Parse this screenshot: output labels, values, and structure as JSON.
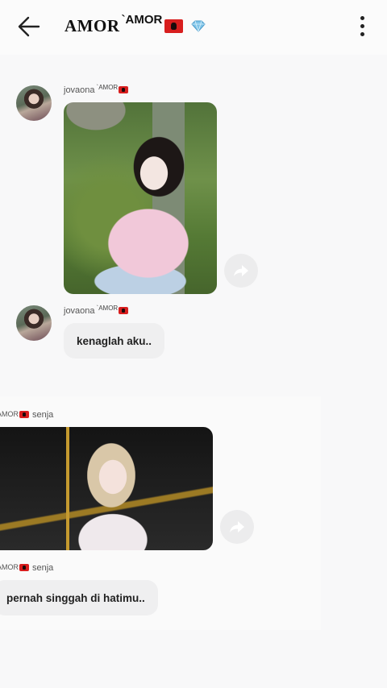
{
  "header": {
    "title_main": "AMOR",
    "title_sup": "`AMOR"
  },
  "messages": [
    {
      "sender_name": "jovaona",
      "sender_sup": "`AMOR",
      "type": "photo"
    },
    {
      "sender_name": "jovaona",
      "sender_sup": "`AMOR",
      "type": "text",
      "text": "kenaglah aku.."
    },
    {
      "sender_prefix": "AMOR",
      "sender_name": "senja",
      "type": "photo"
    },
    {
      "sender_prefix": "AMOR",
      "sender_name": "senja",
      "type": "text",
      "text": "pernah singgah di hatimu.."
    }
  ],
  "colors": {
    "flag": "#d81e1e",
    "bubble": "#efeff0",
    "diamond": "#7fc4e8"
  },
  "icons": [
    "back-arrow-icon",
    "diamond-icon",
    "more-vertical-icon",
    "share-icon"
  ]
}
